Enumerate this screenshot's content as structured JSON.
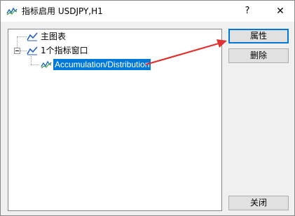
{
  "window": {
    "title": "指标启用 USDJPY,H1",
    "help_label": "?",
    "close_label": "✕"
  },
  "tree": {
    "items": [
      {
        "label": "主图表",
        "icon": "line-chart-icon",
        "level": 0
      },
      {
        "label": "1个指标窗口",
        "icon": "line-chart-icon",
        "level": 0,
        "expanded": true
      },
      {
        "label": "Accumulation/Distribution",
        "icon": "indicator-icon",
        "level": 1,
        "selected": true
      }
    ]
  },
  "buttons": {
    "properties_label": "属性",
    "delete_label": "删除",
    "close_label": "关闭"
  },
  "colors": {
    "selection": "#0078d7",
    "annotation_arrow": "#e03030",
    "icon_blue": "#1f5fbf"
  }
}
